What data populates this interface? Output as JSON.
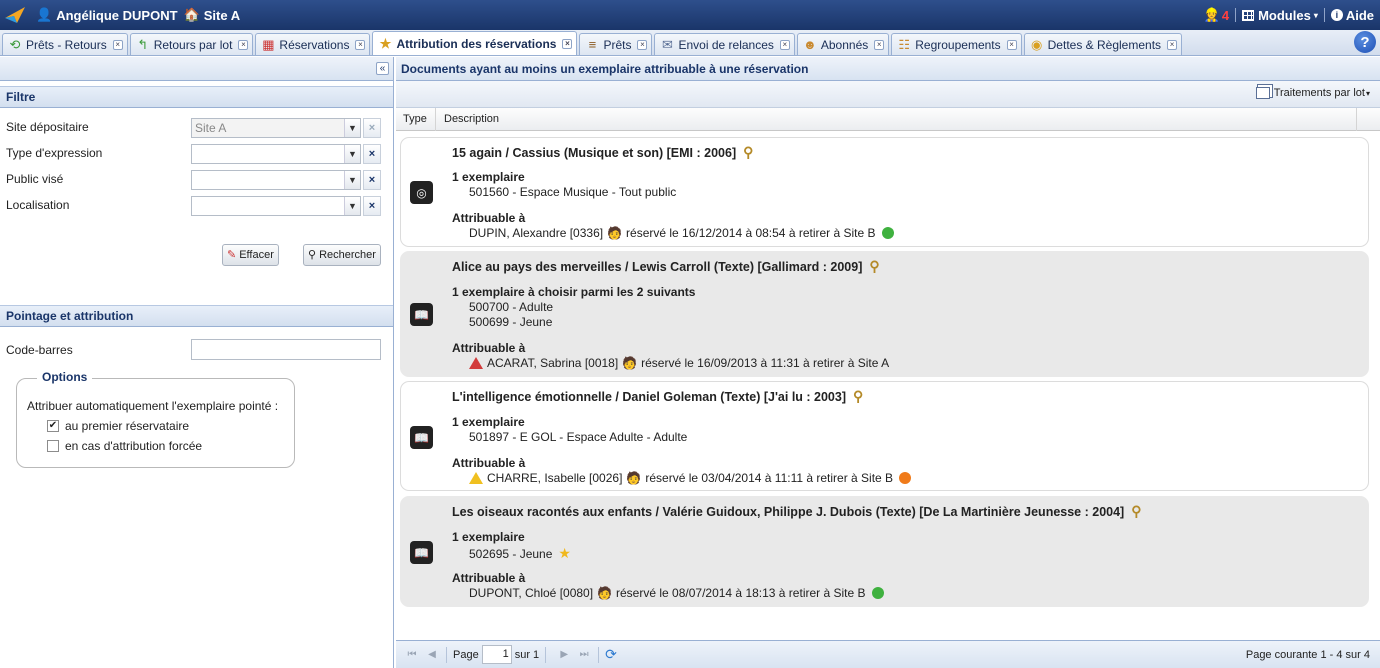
{
  "topbar": {
    "user": "Angélique DUPONT",
    "site": "Site A",
    "notifications": "4",
    "modules": "Modules",
    "help": "Aide"
  },
  "tabs": [
    {
      "label": "Prêts - Retours",
      "icon": "loan-return-icon"
    },
    {
      "label": "Retours par lot",
      "icon": "batch-return-icon"
    },
    {
      "label": "Réservations",
      "icon": "calendar-icon"
    },
    {
      "label": "Attribution des réservations",
      "icon": "star-person-icon",
      "active": true
    },
    {
      "label": "Prêts",
      "icon": "books-icon"
    },
    {
      "label": "Envoi de relances",
      "icon": "envelope-icon"
    },
    {
      "label": "Abonnés",
      "icon": "person-icon"
    },
    {
      "label": "Regroupements",
      "icon": "group-icon"
    },
    {
      "label": "Dettes & Règlements",
      "icon": "coins-icon"
    }
  ],
  "filter": {
    "title": "Filtre",
    "site_label": "Site dépositaire",
    "site_value": "Site A",
    "expression_label": "Type d'expression",
    "public_label": "Public visé",
    "location_label": "Localisation",
    "clear_btn": "Effacer",
    "search_btn": "Rechercher"
  },
  "pointage": {
    "title": "Pointage et attribution",
    "barcode_label": "Code-barres",
    "options_legend": "Options",
    "auto_label": "Attribuer automatiquement l'exemplaire pointé :",
    "opt1": "au premier réservataire",
    "opt1_checked": true,
    "opt2": "en cas d'attribution forcée",
    "opt2_checked": false
  },
  "main": {
    "title": "Documents ayant au moins un exemplaire attribuable à une réservation",
    "batch": "Traitements par lot",
    "col_type": "Type",
    "col_desc": "Description"
  },
  "colors": {
    "green": "#3fb13f",
    "orange": "#f07b1a",
    "accent": "#1a3569"
  },
  "documents": [
    {
      "title": "15 again / Cassius (Musique et son) [EMI : 2006]",
      "type_icon": "music-disc-icon",
      "copies_label": "1 exemplaire",
      "copies": [
        "501560 - Espace Musique - Tout public"
      ],
      "attrib_label": "Attribuable à",
      "reader": "DUPIN, Alexandre [0336]",
      "reservation": "réservé le 16/12/2014 à 08:54 à retirer à Site B",
      "status": "green"
    },
    {
      "title": "Alice au pays des merveilles / Lewis Carroll (Texte) [Gallimard : 2009]",
      "type_icon": "book-icon",
      "copies_label": "1 exemplaire à choisir parmi les 2 suivants",
      "copies": [
        "500700 - Adulte",
        "500699 - Jeune"
      ],
      "attrib_label": "Attribuable à",
      "reader": "ACARAT, Sabrina [0018]",
      "reservation": "réservé le 16/09/2013 à 11:31 à retirer à Site A",
      "warning": "red"
    },
    {
      "title": "L'intelligence émotionnelle / Daniel Goleman (Texte) [J'ai lu : 2003]",
      "type_icon": "book-icon",
      "copies_label": "1 exemplaire",
      "copies": [
        "501897 - E GOL - Espace Adulte - Adulte"
      ],
      "attrib_label": "Attribuable à",
      "reader": "CHARRE, Isabelle [0026]",
      "reservation": "réservé le 03/04/2014 à 11:11 à retirer à Site B",
      "warning": "yellow",
      "status": "orange"
    },
    {
      "title": "Les oiseaux racontés aux enfants / Valérie Guidoux, Philippe J. Dubois (Texte) [De La Martinière Jeunesse : 2004]",
      "type_icon": "book-icon",
      "copies_label": "1 exemplaire",
      "copies": [
        "502695 - Jeune"
      ],
      "attrib_label": "Attribuable à",
      "reader": "DUPONT, Chloé [0080]",
      "reservation": "réservé le 08/07/2014 à 18:13 à retirer à Site B",
      "status": "green"
    }
  ],
  "pager": {
    "page_label": "Page",
    "page_value": "1",
    "of_label": "sur 1",
    "summary": "Page courante 1 - 4 sur 4"
  }
}
